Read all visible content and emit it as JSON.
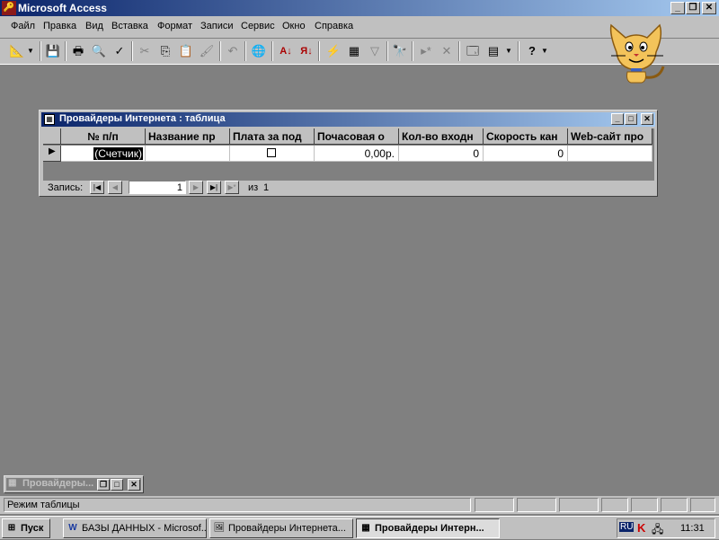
{
  "window": {
    "title": "Microsoft Access"
  },
  "menu": [
    "Файл",
    "Правка",
    "Вид",
    "Вставка",
    "Формат",
    "Записи",
    "Сервис",
    "Окно",
    "Справка"
  ],
  "table_window": {
    "title": "Провайдеры Интернета : таблица",
    "columns": [
      "№ п/п",
      "Название пр",
      "Плата за под",
      "Почасовая о",
      "Кол-во входн",
      "Скорость кан",
      "Web-сайт про"
    ],
    "row": {
      "counter": "(Счетчик)",
      "name": "",
      "fee_checked": false,
      "hourly": "0,00р.",
      "lines": "0",
      "speed": "0",
      "website": ""
    },
    "nav": {
      "label": "Запись:",
      "current": "1",
      "of_label": "из",
      "total": "1"
    }
  },
  "minimized_window": {
    "title": "Провайдеры..."
  },
  "status": {
    "text": "Режим таблицы"
  },
  "taskbar": {
    "start": "Пуск",
    "buttons": [
      "БАЗЫ ДАННЫХ - Microsof...",
      "Провайдеры Интернета...",
      "Провайдеры Интерн..."
    ],
    "lang": "RU",
    "clock": "11:31"
  }
}
